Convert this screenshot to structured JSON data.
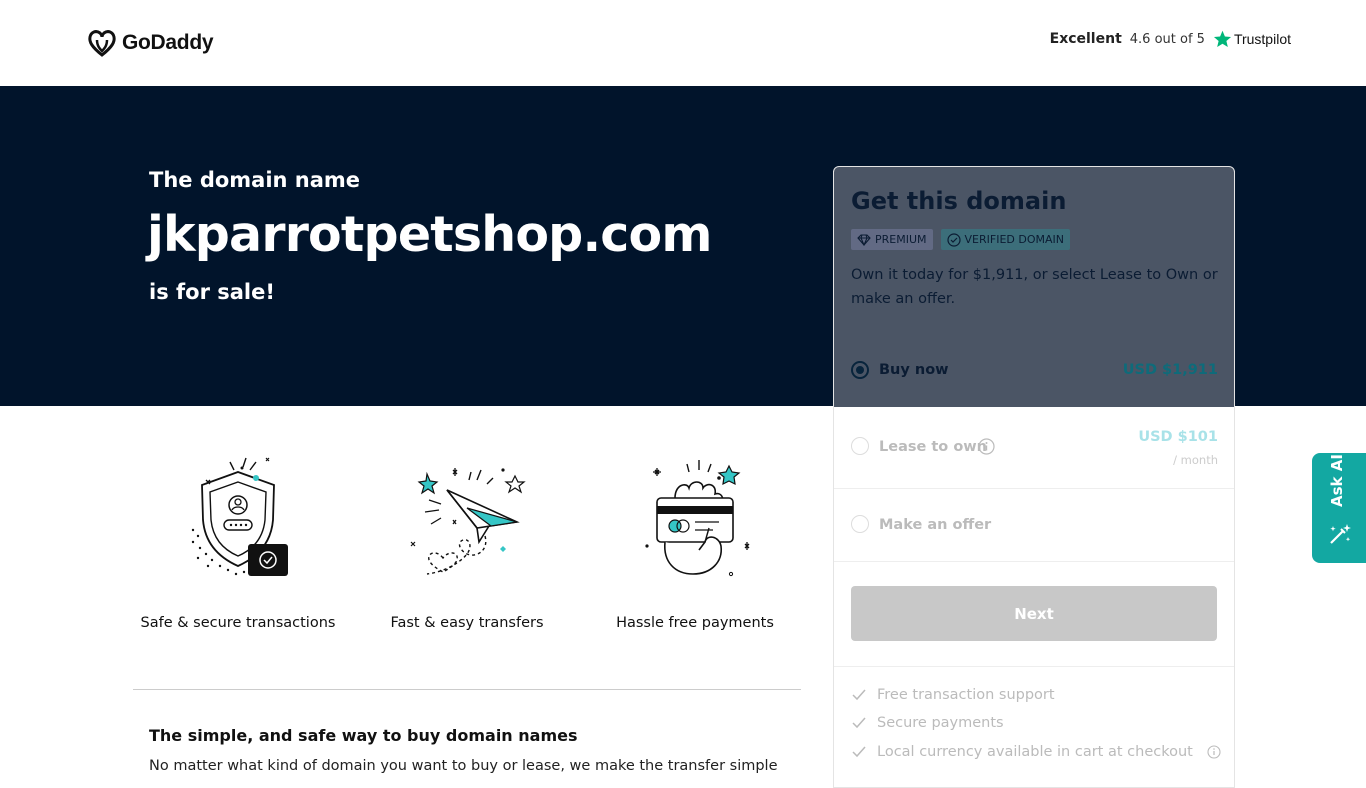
{
  "header": {
    "brand_name": "GoDaddy",
    "trust_rating_word": "Excellent",
    "trust_score": "4.6 out of 5",
    "trust_brand": "Trustpilot"
  },
  "hero": {
    "pre_text": "The domain name",
    "domain": "jkparrotpetshop.com",
    "post_text": "is for sale!"
  },
  "features": [
    {
      "label": "Safe & secure transactions",
      "icon": "shield-icon"
    },
    {
      "label": "Fast & easy transfers",
      "icon": "paper-plane-icon"
    },
    {
      "label": "Hassle free payments",
      "icon": "card-payment-icon"
    }
  ],
  "info": {
    "title": "The simple, and safe way to buy domain names",
    "text": "No matter what kind of domain you want to buy or lease, we make the transfer simple"
  },
  "card": {
    "title": "Get this domain",
    "badge_premium": "PREMIUM",
    "badge_verified": "VERIFIED DOMAIN",
    "description": "Own it today for $1,911, or select Lease to Own or make an offer.",
    "options": [
      {
        "label": "Buy now",
        "price": "USD $1,911",
        "selected": true
      },
      {
        "label": "Lease to own",
        "price": "USD $101",
        "subprice": "/ month",
        "selected": false
      },
      {
        "label": "Make an offer",
        "selected": false
      }
    ],
    "next_label": "Next",
    "perks": [
      "Free transaction support",
      "Secure payments",
      "Local currency available in cart at checkout"
    ]
  },
  "ask_ai": {
    "label": "Ask AI"
  },
  "colors": {
    "hero_bg": "#01142b",
    "accent_teal": "#13a8a2",
    "overlay": "#4b5565",
    "trustpilot_green": "#00b67a"
  }
}
